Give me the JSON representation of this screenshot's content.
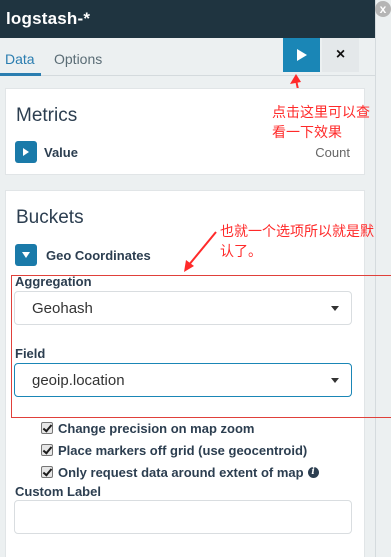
{
  "header": {
    "title": "logstash-*"
  },
  "scrollbar": {
    "close_glyph": "x"
  },
  "tabs": [
    {
      "label": "Data",
      "active": true
    },
    {
      "label": "Options",
      "active": false
    }
  ],
  "toolbar": {
    "apply_icon": "play-icon",
    "discard_glyph": "×"
  },
  "annotations": {
    "apply_note_line1": "点击这里可以查",
    "apply_note_line2": "看一下效果",
    "geo_note_line1": "也就一个选项所以就是默",
    "geo_note_line2": "认了。"
  },
  "metrics": {
    "title": "Metrics",
    "agg_name": "Value",
    "agg_type": "Count"
  },
  "buckets": {
    "title": "Buckets",
    "agg_name": "Geo Coordinates",
    "aggregation_label": "Aggregation",
    "aggregation_value": "Geohash",
    "field_label": "Field",
    "field_value": "geoip.location",
    "options": [
      {
        "label": "Change precision on map zoom",
        "checked": true
      },
      {
        "label": "Place markers off grid (use geocentroid)",
        "checked": true
      },
      {
        "label": "Only request data around extent of map",
        "checked": true,
        "info": true
      }
    ],
    "custom_label_label": "Custom Label",
    "custom_label_value": ""
  },
  "colors": {
    "header_bg": "#1f3440",
    "accent": "#1a86b6",
    "annotation_red": "#ff2a2a"
  }
}
